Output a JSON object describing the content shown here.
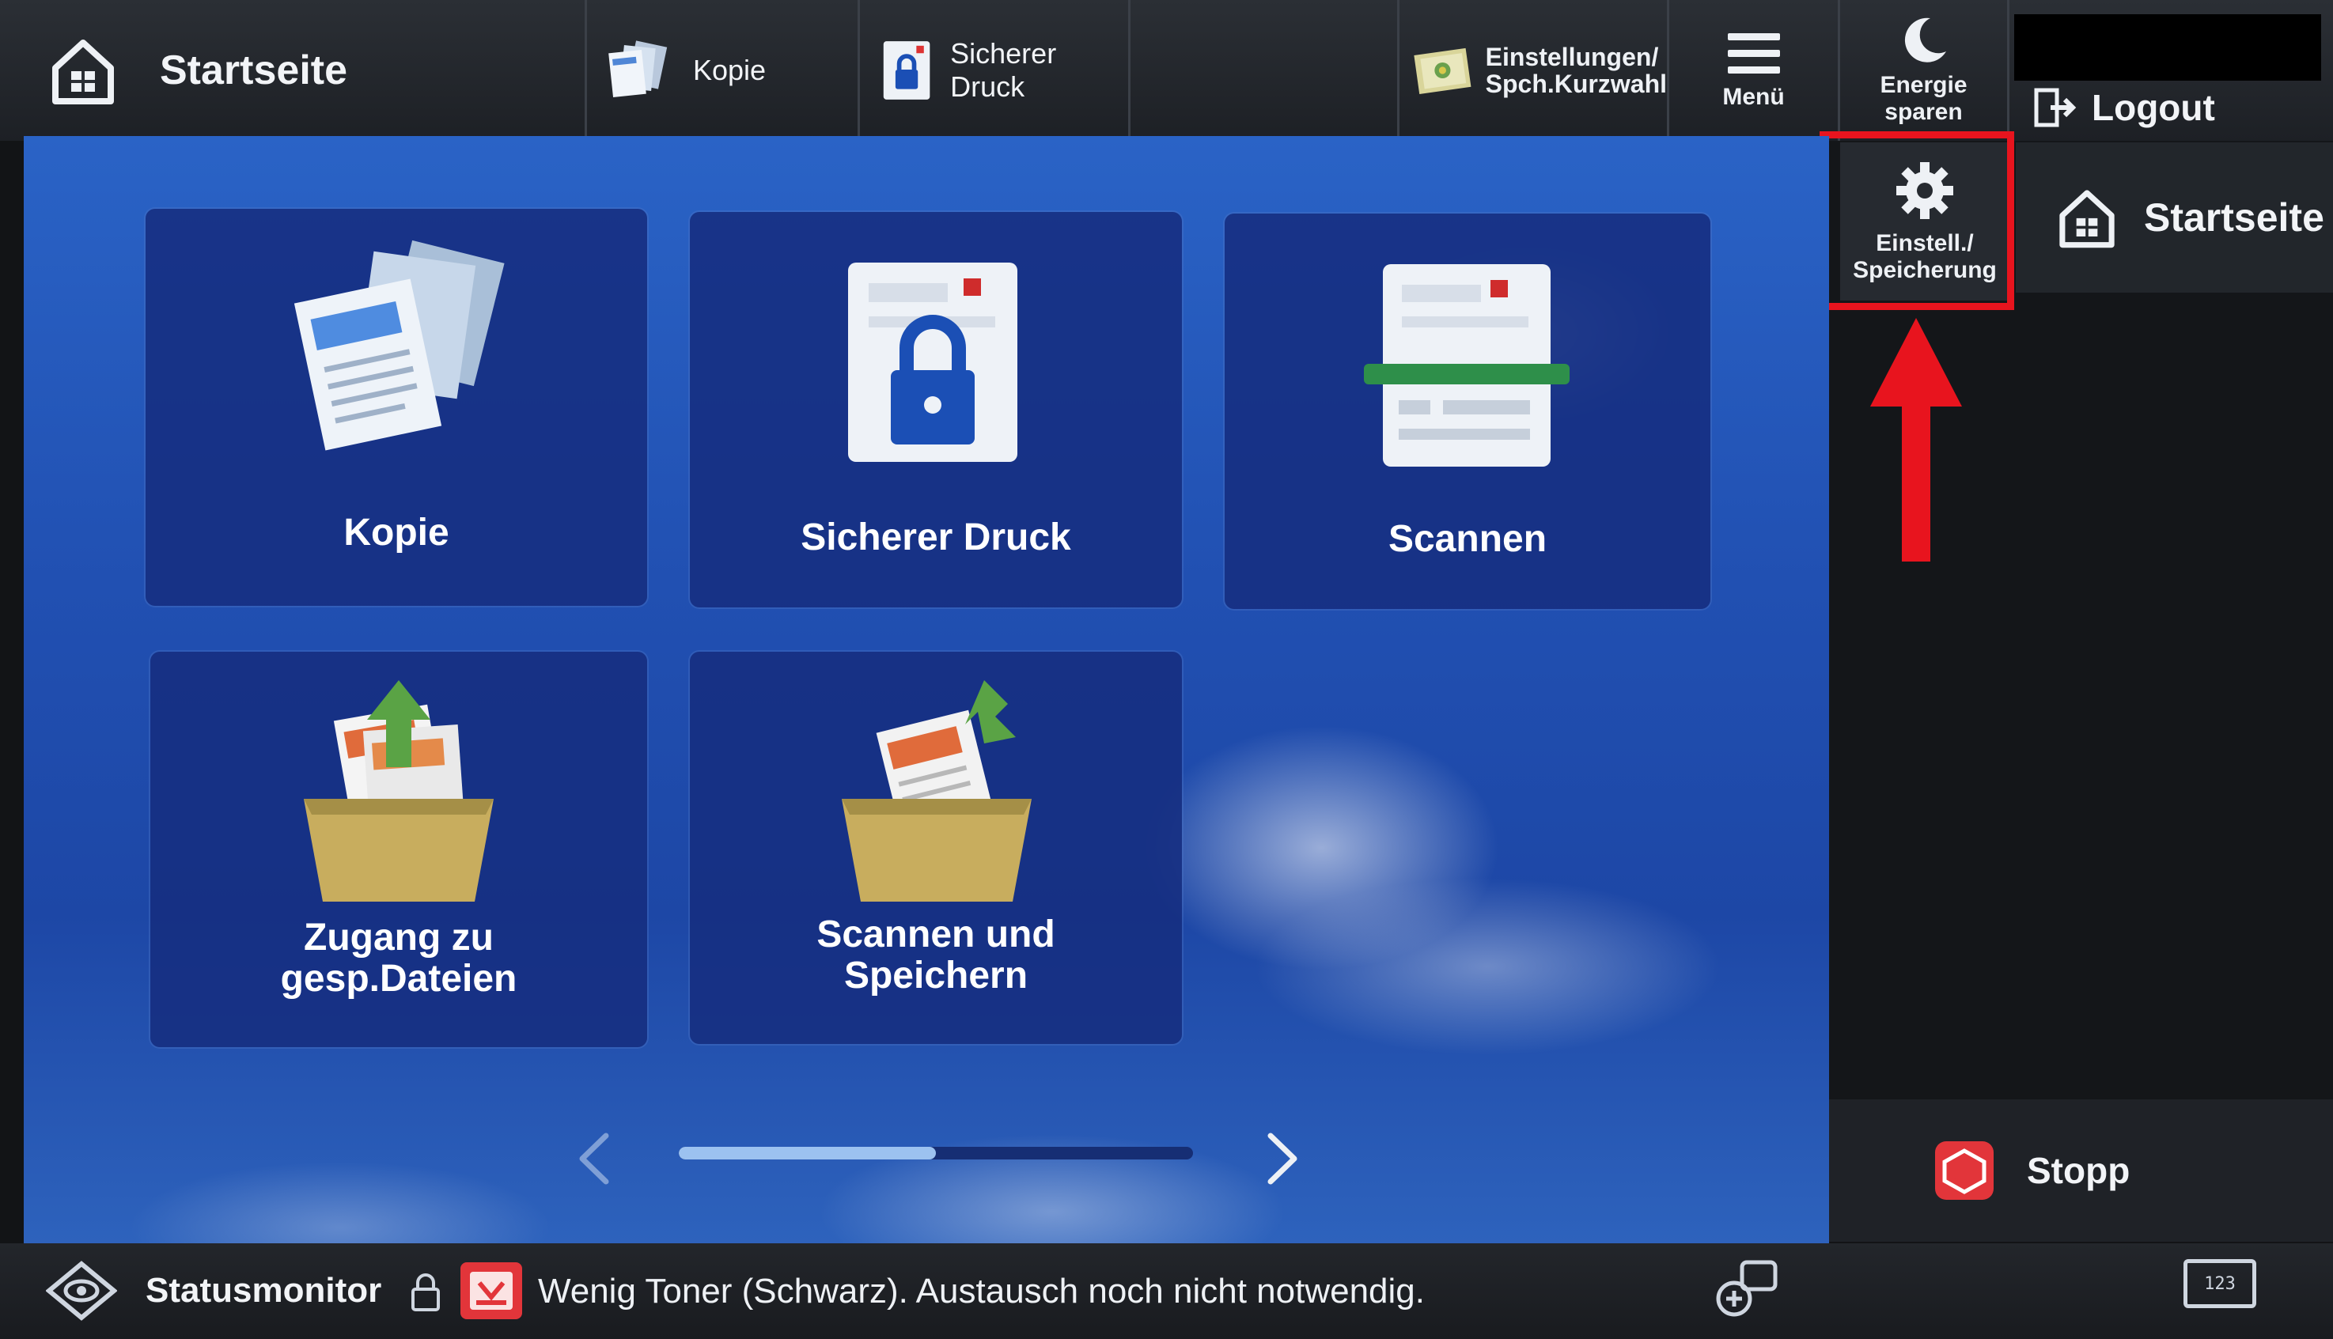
{
  "topbar": {
    "home_label": "Startseite",
    "copy_label": "Kopie",
    "secure_print_label": "Sicherer Druck",
    "settings_label_line1": "Einstellungen/",
    "settings_label_line2": "Spch.Kurzwahl",
    "menu_label": "Menü",
    "energy_label": "Energie sparen",
    "logout_label": "Logout"
  },
  "side": {
    "settings_line1": "Einstell./",
    "settings_line2": "Speicherung",
    "home_label": "Startseite",
    "stop_label": "Stopp"
  },
  "tiles": [
    {
      "label": "Kopie"
    },
    {
      "label": "Sicherer Druck"
    },
    {
      "label": "Scannen"
    },
    {
      "label_line1": "Zugang zu",
      "label_line2": "gesp.Dateien"
    },
    {
      "label_line1": "Scannen und",
      "label_line2": "Speichern"
    }
  ],
  "pager": {
    "progress": 0.5
  },
  "bottombar": {
    "status_monitor_label": "Statusmonitor",
    "status_message": "Wenig Toner (Schwarz). Austausch noch nicht notwendig.",
    "keypad_label": "123"
  },
  "colors": {
    "highlight": "#e8141e",
    "stop_red": "#e2353a"
  }
}
